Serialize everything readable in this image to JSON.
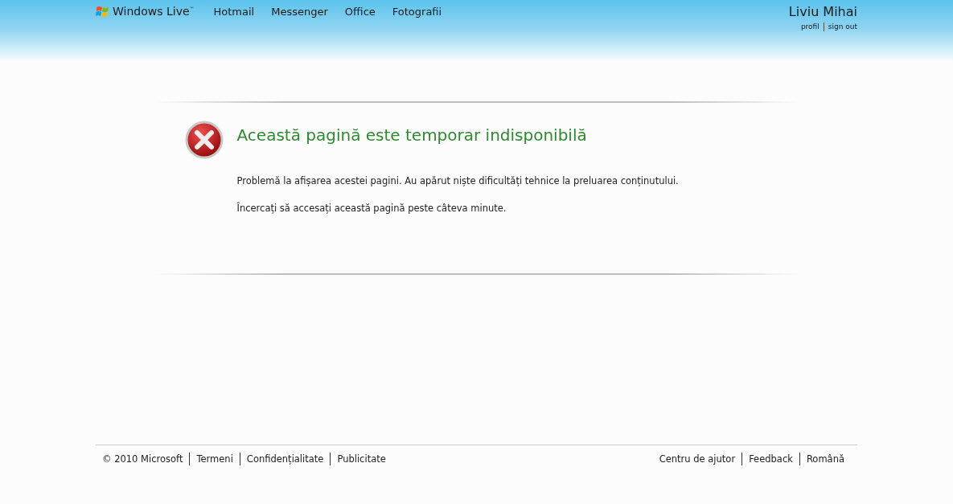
{
  "header": {
    "brand": "Windows Live$^{™}$",
    "nav": [
      "Hotmail",
      "Messenger",
      "Office",
      "Fotografii"
    ],
    "user": {
      "name": "Liviu Mihai",
      "links": [
        "profil",
        "sign out"
      ]
    }
  },
  "error": {
    "title": "Această pagină este temporar indisponibilă",
    "paragraphs": [
      "Problemă la afișarea acestei pagini. Au apărut niște dificultăți tehnice la preluarea conținutului.",
      "Încercați să accesați această pagină peste câteva minute."
    ]
  },
  "footer": {
    "left": [
      "© 2010 Microsoft",
      "Termeni",
      "Confidențialitate",
      "Publicitate"
    ],
    "right": [
      "Centru de ajutor",
      "Feedback",
      "Română"
    ]
  }
}
